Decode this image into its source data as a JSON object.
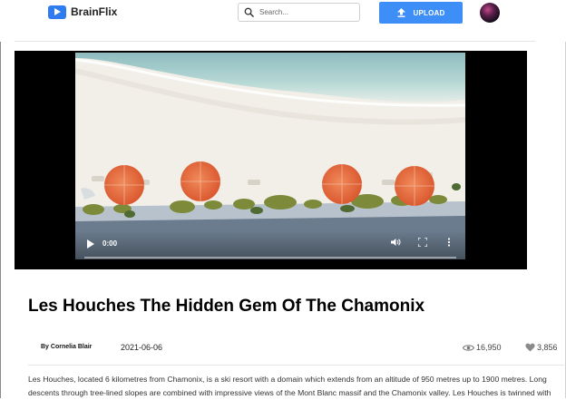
{
  "app": {
    "brand": "BrainFlix",
    "accent": "#3d8ef7",
    "icons": [
      "play-logo-icon",
      "search-icon",
      "upload-icon",
      "play-icon",
      "volume-icon",
      "fullscreen-icon",
      "more-icon",
      "eye-icon",
      "heart-icon"
    ]
  },
  "header": {
    "search_placeholder": "Search...",
    "upload_label": "UPLOAD"
  },
  "player": {
    "current_time": "0:00",
    "progress": 0
  },
  "video": {
    "title": "Les Houches The Hidden Gem Of The Chamonix",
    "author": "By Cornelia Blair",
    "date": "2021-06-06",
    "views": "16,950",
    "likes": "3,856",
    "description": "Les Houches, located 6 kilometres from Chamonix, is a ski resort with a domain which extends from an altitude of 950 metres up to 1900 metres. Long\ndescents through tree-lined slopes are combined with impressive views of the Mont Blanc massif and the Chamonix valley. Les Houches is twinned with"
  }
}
